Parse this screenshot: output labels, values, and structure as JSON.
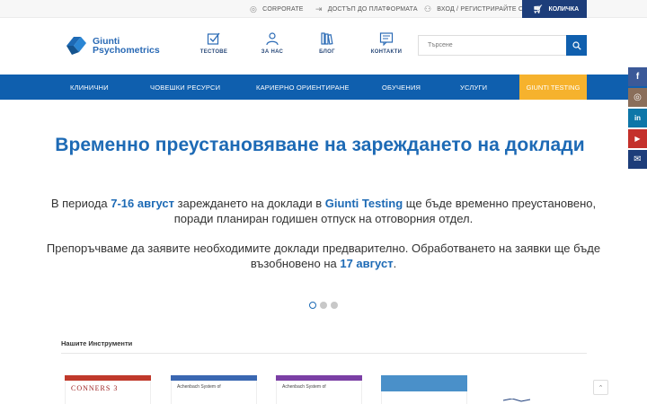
{
  "topbar": {
    "corporate": "CORPORATE",
    "platform": "ДОСТЪП ДО ПЛАТФОРМАТА",
    "login": "ВХОД / РЕГИСТРИРАЙТЕ СЕ",
    "cart": "КОЛИЧКА"
  },
  "header": {
    "logo_line1": "Giunti",
    "logo_line2": "Psychometrics",
    "icons": [
      {
        "label": "ТЕСТОВЕ",
        "icon": "check-box-icon"
      },
      {
        "label": "ЗА НАС",
        "icon": "user-icon"
      },
      {
        "label": "БЛОГ",
        "icon": "books-icon"
      },
      {
        "label": "КОНТАКТИ",
        "icon": "contact-form-icon"
      }
    ],
    "search_placeholder": "Търсене"
  },
  "menu": {
    "items": [
      "КЛИНИЧНИ",
      "ЧОВЕШКИ РЕСУРСИ",
      "КАРИЕРНО ОРИЕНТИРАНЕ",
      "ОБУЧЕНИЯ",
      "УСЛУГИ"
    ],
    "active": "GIUNTI TESTING"
  },
  "social": [
    {
      "name": "facebook",
      "glyph": "f",
      "color": "#3b5998"
    },
    {
      "name": "instagram",
      "glyph": "◎",
      "color": "#8a6e5a"
    },
    {
      "name": "linkedin",
      "glyph": "in",
      "color": "#0e76a8"
    },
    {
      "name": "youtube",
      "glyph": "▶",
      "color": "#c4302b"
    },
    {
      "name": "email",
      "glyph": "✉",
      "color": "#1d3d7a"
    }
  ],
  "hero": {
    "title": "Временно преустановяване на зареждането на доклади",
    "p1_a": "В периода ",
    "p1_b": "7-16 август",
    "p1_c": " зареждането на доклади в ",
    "p1_d": "Giunti Testing",
    "p1_e": " ще бъде временно преустановено, поради планиран годишен отпуск на отговорния отдел.",
    "p2_a": "Препоръчваме да заявите необходимите доклади предварително. Обработването на заявки ще бъде възобновено на ",
    "p2_b": "17 август",
    "p2_c": "."
  },
  "slider": {
    "count": 3,
    "active": 1
  },
  "instruments": {
    "title": "Нашите Инструменти",
    "books": [
      {
        "band": "#c0392b",
        "line": "CONNERS 3"
      },
      {
        "band": "#3a67b1",
        "line": "Achenbach System of"
      },
      {
        "band": "#7b3fa5",
        "line": "Achenbach System of"
      },
      {
        "band": "#4a90c9",
        "line": ""
      }
    ]
  },
  "colors": {
    "primary": "#0f5fae",
    "accent": "#f6b22d",
    "dark": "#1d3d7a",
    "highlight": "#1d6ab5"
  }
}
